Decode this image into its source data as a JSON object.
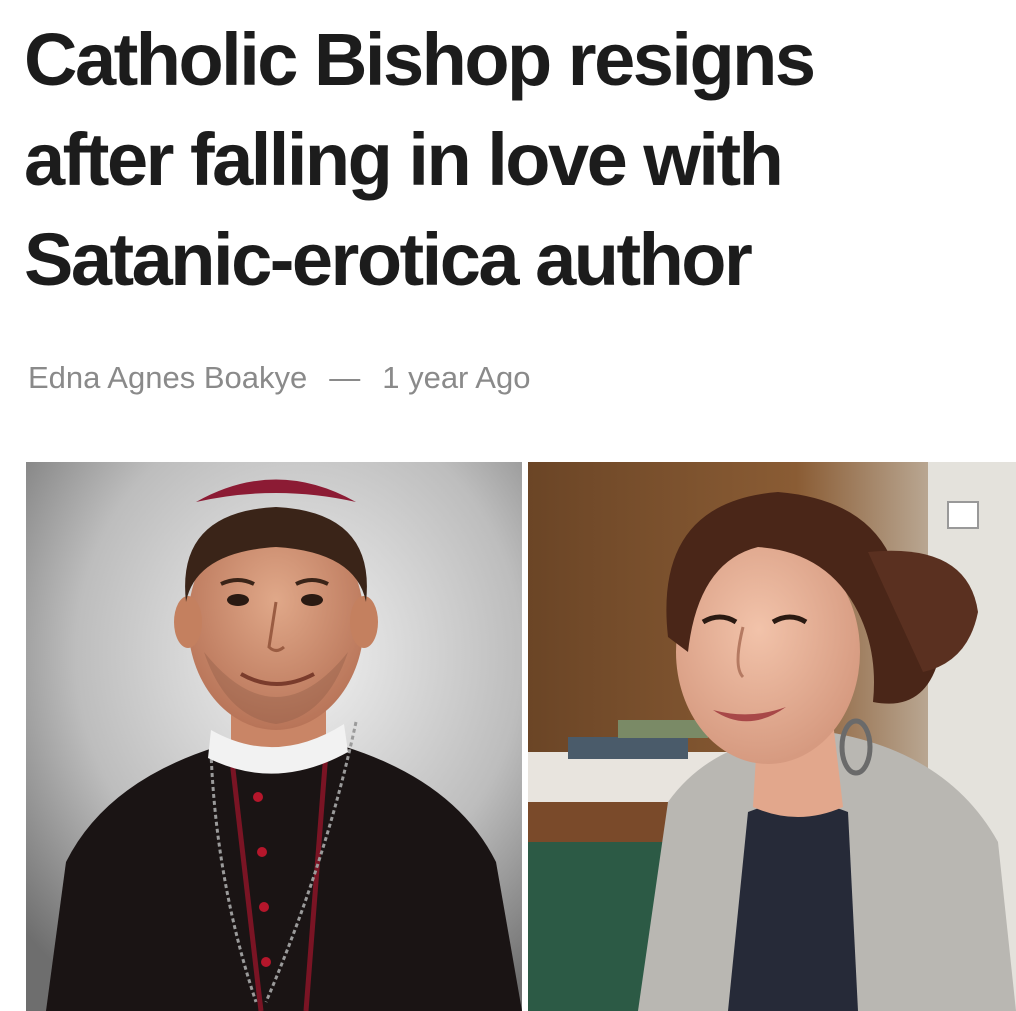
{
  "article": {
    "headline_line1": "Catholic Bishop resigns",
    "headline_line2": "after falling in love with",
    "headline_line3": "Satanic-erotica author",
    "author": "Edna Agnes Boakye",
    "separator": "—",
    "published": "1 year Ago"
  },
  "photos": {
    "left_subject": "bishop-portrait",
    "right_subject": "woman-portrait"
  },
  "colors": {
    "headline": "#1c1c1c",
    "byline": "#8a8a8a",
    "background": "#ffffff"
  }
}
